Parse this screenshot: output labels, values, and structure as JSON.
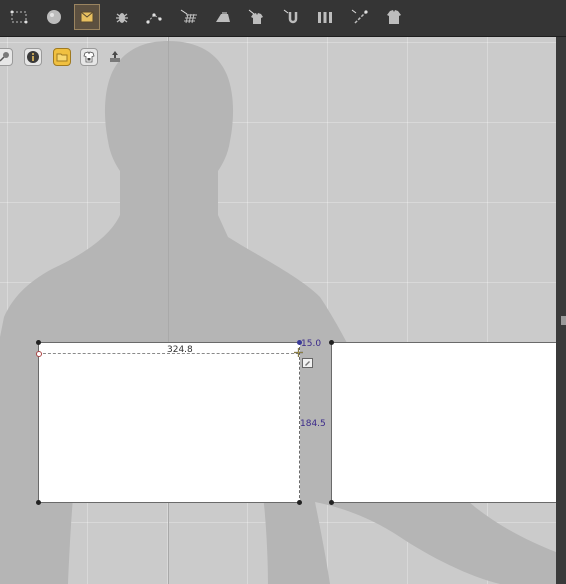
{
  "toolbar": {
    "tools": [
      {
        "icon": "segment-select-icon",
        "active": false
      },
      {
        "icon": "sphere-icon",
        "active": false
      },
      {
        "icon": "fold-pattern-icon",
        "active": true
      },
      {
        "icon": "bug-tool-icon",
        "active": false
      },
      {
        "icon": "arrange-points-icon",
        "active": false
      },
      {
        "icon": "grid-texture-icon",
        "active": false
      },
      {
        "icon": "iron-icon",
        "active": false
      },
      {
        "icon": "stitch-garment-icon",
        "active": false
      },
      {
        "icon": "magnet-icon",
        "active": false
      },
      {
        "icon": "columns-icon",
        "active": false
      },
      {
        "icon": "line-edit-icon",
        "active": false
      },
      {
        "icon": "shirt-icon",
        "active": false
      }
    ]
  },
  "viewport_tools": [
    {
      "icon": "pin-icon"
    },
    {
      "icon": "info-icon"
    },
    {
      "icon": "folder-icon"
    },
    {
      "icon": "shirt-lock-icon"
    },
    {
      "icon": "export-icon"
    }
  ],
  "patterns": {
    "pattern_a": {
      "width_label": "324.8",
      "offset_label": "15.0",
      "height_label": "184.5"
    }
  },
  "colors": {
    "toolbar_bg": "#353535",
    "viewport_bg": "#cbcbcb",
    "avatar": "#b5b5b5",
    "pattern_fill": "#ffffff",
    "dimension_accent": "#3b2a8a",
    "active_tool": "#5c5040"
  }
}
